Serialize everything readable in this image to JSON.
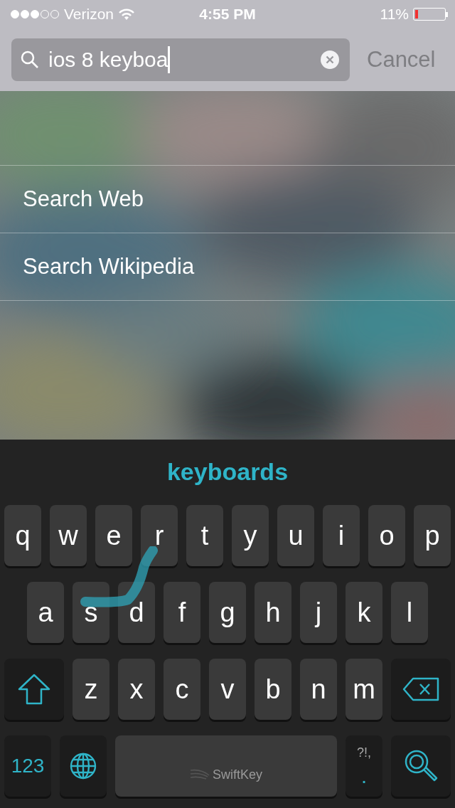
{
  "status_bar": {
    "carrier": "Verizon",
    "time": "4:55 PM",
    "battery_percent": "11%",
    "battery": {
      "level": 0.11
    }
  },
  "search": {
    "value": "ios 8 keyboa",
    "cancel": "Cancel"
  },
  "results": [
    {
      "label": "Search Web"
    },
    {
      "label": "Search Wikipedia"
    }
  ],
  "keyboard": {
    "suggestion": "keyboards",
    "top_row": [
      {
        "kind": "letter",
        "label": "q"
      },
      {
        "kind": "letter",
        "label": "w"
      },
      {
        "kind": "letter",
        "label": "e"
      },
      {
        "kind": "letter",
        "label": "r"
      },
      {
        "kind": "letter",
        "label": "t"
      },
      {
        "kind": "letter",
        "label": "y"
      },
      {
        "kind": "letter",
        "label": "u"
      },
      {
        "kind": "letter",
        "label": "i"
      },
      {
        "kind": "letter",
        "label": "o"
      },
      {
        "kind": "letter",
        "label": "p"
      }
    ],
    "middle_row": [
      {
        "kind": "letter",
        "label": "a"
      },
      {
        "kind": "letter",
        "label": "s"
      },
      {
        "kind": "letter",
        "label": "d"
      },
      {
        "kind": "letter",
        "label": "f"
      },
      {
        "kind": "letter",
        "label": "g"
      },
      {
        "kind": "letter",
        "label": "h"
      },
      {
        "kind": "letter",
        "label": "j"
      },
      {
        "kind": "letter",
        "label": "k"
      },
      {
        "kind": "letter",
        "label": "l"
      }
    ],
    "bottom_row": [
      {
        "kind": "shift"
      },
      {
        "kind": "letter",
        "label": "z"
      },
      {
        "kind": "letter",
        "label": "x"
      },
      {
        "kind": "letter",
        "label": "c"
      },
      {
        "kind": "letter",
        "label": "v"
      },
      {
        "kind": "letter",
        "label": "b"
      },
      {
        "kind": "letter",
        "label": "n"
      },
      {
        "kind": "letter",
        "label": "m"
      },
      {
        "kind": "delete"
      }
    ],
    "function_row": [
      {
        "kind": "numbers",
        "label": "123"
      },
      {
        "kind": "globe"
      },
      {
        "kind": "space",
        "label": "SwiftKey"
      },
      {
        "kind": "punctuation",
        "label": "?!,",
        "sublabel": "."
      },
      {
        "kind": "search"
      }
    ]
  }
}
